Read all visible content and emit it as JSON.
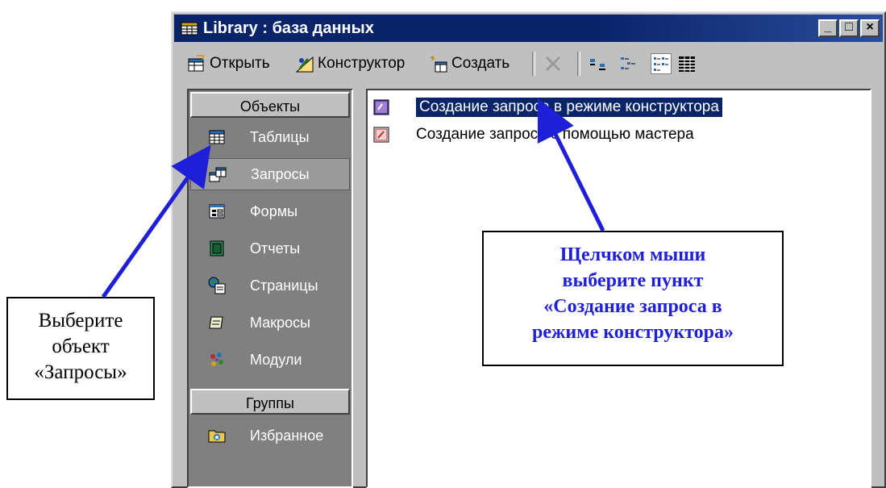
{
  "window": {
    "title": "Library : база данных",
    "buttons": {
      "minimize": "_",
      "maximize": "□",
      "close": "×"
    }
  },
  "toolbar": {
    "open_label": "Открыть",
    "designer_label": "Конструктор",
    "create_label": "Создать"
  },
  "objects_panel": {
    "objects_header": "Объекты",
    "items": [
      {
        "label": "Таблицы",
        "icon": "table-icon"
      },
      {
        "label": "Запросы",
        "icon": "query-icon"
      },
      {
        "label": "Формы",
        "icon": "form-icon"
      },
      {
        "label": "Отчеты",
        "icon": "report-icon"
      },
      {
        "label": "Страницы",
        "icon": "page-icon"
      },
      {
        "label": "Макросы",
        "icon": "macro-icon"
      },
      {
        "label": "Модули",
        "icon": "module-icon"
      }
    ],
    "selected": "Запросы",
    "groups_header": "Группы",
    "groups": [
      {
        "label": "Избранное",
        "icon": "favorites-icon"
      }
    ]
  },
  "list": {
    "items": [
      {
        "label": "Создание запроса в режиме конструктора",
        "selected": true
      },
      {
        "label": "Создание запросе с помощью мастера",
        "selected": false
      }
    ]
  },
  "callouts": {
    "left": [
      "Выберите",
      "объект",
      "«Запросы»"
    ],
    "right": [
      "Щелчком мыши",
      "выберите пункт",
      "«Создание запроса в",
      "режиме конструктора»"
    ]
  },
  "colors": {
    "title_bar": "#0a246a",
    "arrow": "#1f1fd8",
    "callout_text": "#1f1fd8",
    "panel_bg": "#808080"
  }
}
